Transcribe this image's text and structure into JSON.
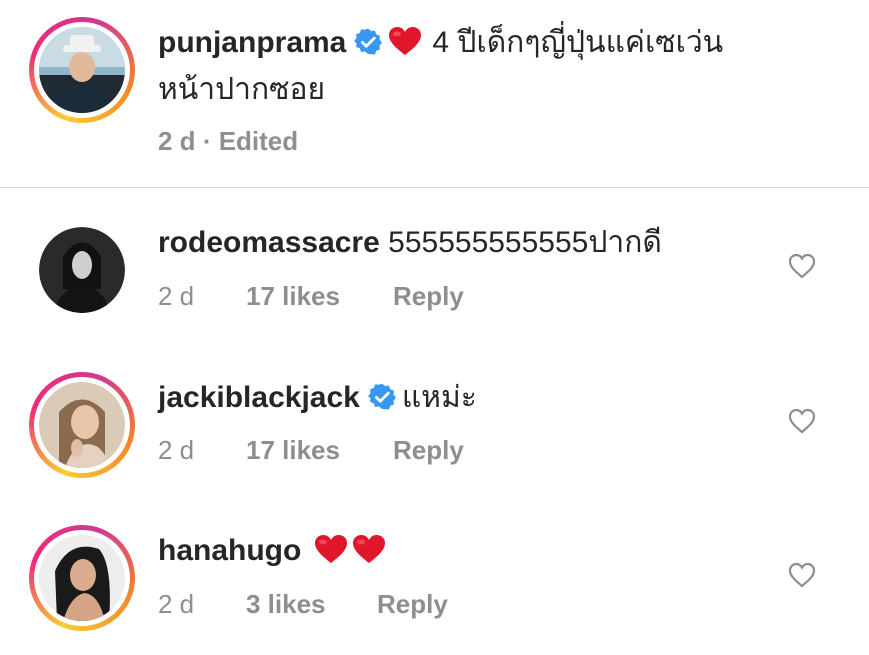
{
  "caption": {
    "username": "punjanprama",
    "text_line1": "4 ปีเด็กๆญี่ปุ่นแค่เซเว่น",
    "text_line2": "หน้าปากซอย",
    "time": "2 d",
    "edited": "· Edited"
  },
  "comments": [
    {
      "username": "rodeomassacre",
      "text": "555555555555ปากดี",
      "time": "2 d",
      "likes": "17 likes",
      "reply": "Reply"
    },
    {
      "username": "jackiblackjack",
      "text": "แหม่ะ",
      "time": "2 d",
      "likes": "17 likes",
      "reply": "Reply"
    },
    {
      "username": "hanahugo",
      "text": "",
      "time": "2 d",
      "likes": "3 likes",
      "reply": "Reply"
    }
  ],
  "colors": {
    "text": "#262626",
    "secondary": "#8e8e8e",
    "verified": "#3897f0",
    "heart_emoji": "#e0162b",
    "divider": "#dbdbdb"
  },
  "icons": {
    "verified": "verified-badge-icon",
    "heart_emoji": "red-heart-emoji",
    "like": "heart-outline-icon"
  }
}
